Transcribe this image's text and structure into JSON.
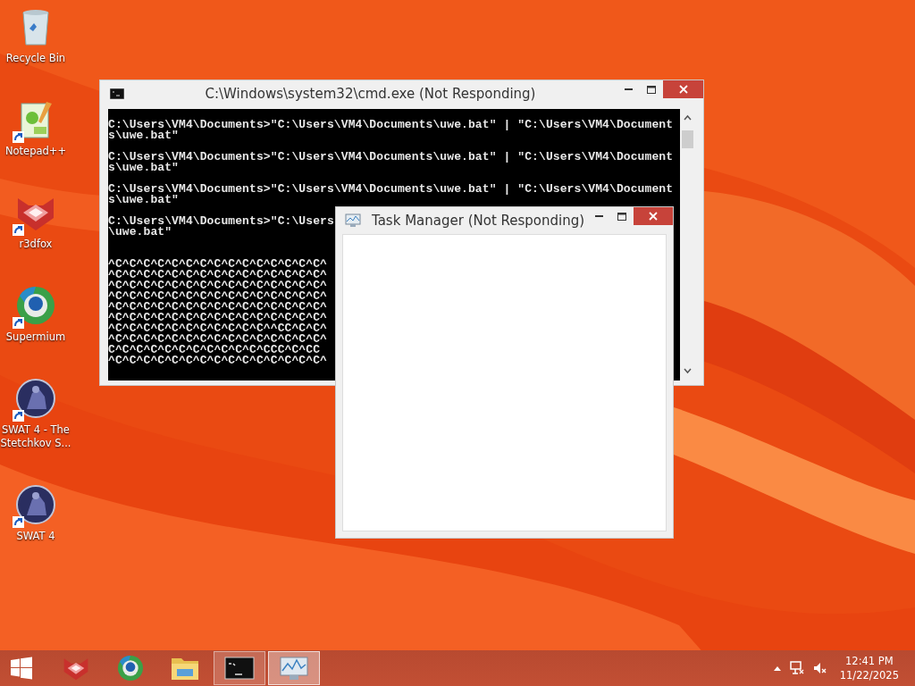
{
  "desktop_icons": [
    {
      "kind": "recycle",
      "label": "Recycle Bin",
      "shortcut": false
    },
    {
      "kind": "notepad",
      "label": "Notepad++",
      "shortcut": true
    },
    {
      "kind": "fox",
      "label": "r3dfox",
      "shortcut": true
    },
    {
      "kind": "browser",
      "label": "Supermium",
      "shortcut": true
    },
    {
      "kind": "game",
      "label": "SWAT 4 - The Stetchkov S...",
      "shortcut": true
    },
    {
      "kind": "game",
      "label": "SWAT 4",
      "shortcut": true
    }
  ],
  "cmd_window": {
    "title": "C:\\Windows\\system32\\cmd.exe (Not Responding)",
    "blocks": [
      {
        "kind": "command",
        "lines": [
          "C:\\Users\\VM4\\Documents>\"C:\\Users\\VM4\\Documents\\uwe.bat\" | \"C:\\Users\\VM4\\Document",
          "s\\uwe.bat\""
        ]
      },
      {
        "kind": "command",
        "lines": [
          "C:\\Users\\VM4\\Documents>\"C:\\Users\\VM4\\Documents\\uwe.bat\" | \"C:\\Users\\VM4\\Document",
          "s\\uwe.bat\""
        ]
      },
      {
        "kind": "command",
        "lines": [
          "C:\\Users\\VM4\\Documents>\"C:\\Users\\VM4\\Documents\\uwe.bat\" | \"C:\\Users\\VM4\\Document",
          "s\\uwe.bat\""
        ]
      },
      {
        "kind": "command",
        "lines": [
          "C:\\Users\\VM4\\Documents>\"C:\\Users",
          "\\uwe.bat\""
        ]
      },
      {
        "kind": "interrupt",
        "lines": [
          "^C^C^C^C^C^C^C^C^C^C^C^C^C^C^C^",
          "^C^C^C^C^C^C^C^C^C^C^C^C^C^C^C^",
          "^C^C^C^C^C^C^C^C^C^C^C^C^C^C^C^",
          "^C^C^C^C^C^C^C^C^C^C^C^C^C^C^C^",
          "^C^C^C^C^C^C^C^C^C^C^C^C^C^C^C^",
          "^C^C^C^C^C^C^C^C^C^C^C^C^C^C^C^",
          "^C^C^C^C^C^C^C^C^C^C^C^^CC^C^C^",
          "^C^C^C^C^C^C^C^C^C^C^C^C^C^C^C^",
          "C^C^C^C^C^C^C^C^C^C^C^CCC^C^CC",
          "^C^C^C^C^C^C^C^C^C^C^C^C^C^C^C^"
        ]
      }
    ]
  },
  "task_manager": {
    "title": "Task Manager (Not Responding)"
  },
  "taskbar": {
    "items": [
      {
        "kind": "start",
        "running": false,
        "selected": false
      },
      {
        "kind": "fox",
        "running": false,
        "selected": false
      },
      {
        "kind": "browser",
        "running": false,
        "selected": false
      },
      {
        "kind": "folder",
        "running": false,
        "selected": false
      },
      {
        "kind": "console",
        "running": true,
        "selected": false
      },
      {
        "kind": "monitor",
        "running": true,
        "selected": true
      }
    ],
    "time": "12:41 PM",
    "date": "11/22/2025"
  }
}
